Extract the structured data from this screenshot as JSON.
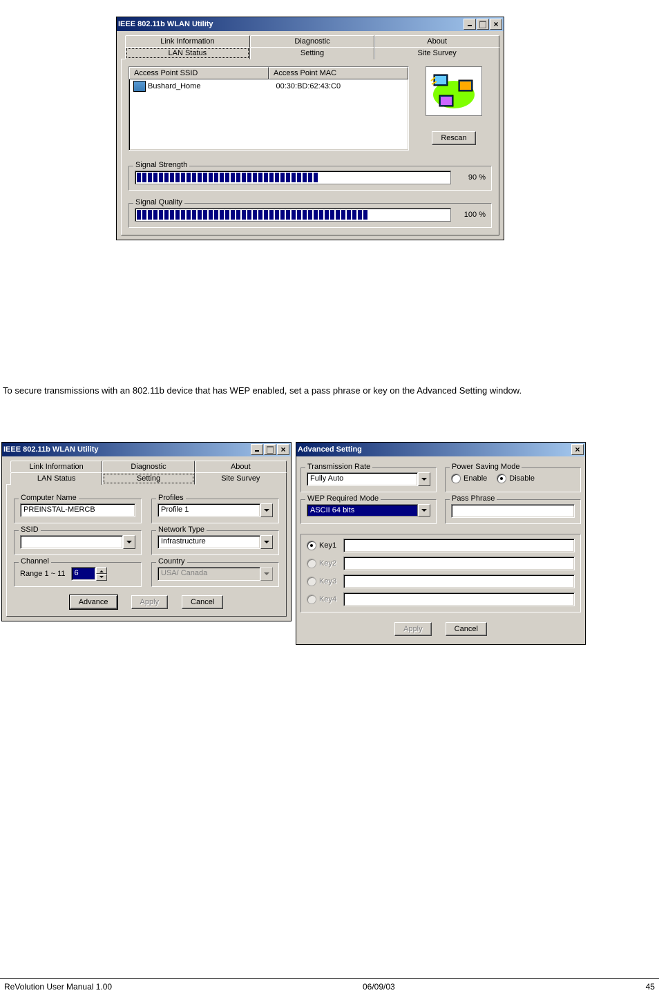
{
  "win1": {
    "title": "IEEE 802.11b WLAN Utility",
    "tabs_row1": [
      "Link Information",
      "Diagnostic",
      "About"
    ],
    "tabs_row2": [
      "LAN Status",
      "Setting",
      "Site Survey"
    ],
    "active_tab": "LAN Status",
    "list": {
      "col_ssid": "Access Point SSID",
      "col_mac": "Access Point MAC",
      "row_ssid": "Bushard_Home",
      "row_mac": "00:30:BD:62:43:C0"
    },
    "rescan": "Rescan",
    "signal_strength": {
      "label": "Signal Strength",
      "pct": "90 %",
      "segs": 33
    },
    "signal_quality": {
      "label": "Signal Quality",
      "pct": "100 %",
      "segs": 42
    }
  },
  "body_text": "To secure transmissions with an 802.11b device that has WEP enabled, set a pass phrase or key on the Advanced Setting window.",
  "win2": {
    "title": "IEEE 802.11b WLAN Utility",
    "tabs_row1": [
      "Link Information",
      "Diagnostic",
      "About"
    ],
    "tabs_row2": [
      "LAN Status",
      "Setting",
      "Site Survey"
    ],
    "active_tab": "Setting",
    "computer_name": {
      "label": "Computer Name",
      "value": "PREINSTAL-MERCB"
    },
    "profiles": {
      "label": "Profiles",
      "value": "Profile 1"
    },
    "ssid": {
      "label": "SSID",
      "value": ""
    },
    "network_type": {
      "label": "Network Type",
      "value": "Infrastructure"
    },
    "channel": {
      "label": "Channel",
      "range": "Range 1 ~ 11",
      "value": "6"
    },
    "country": {
      "label": "Country",
      "value": "USA/ Canada"
    },
    "advance": "Advance",
    "apply": "Apply",
    "cancel": "Cancel"
  },
  "win3": {
    "title": "Advanced Setting",
    "tx_rate": {
      "label": "Transmission Rate",
      "value": "Fully Auto"
    },
    "power": {
      "label": "Power Saving Mode",
      "enable": "Enable",
      "disable": "Disable",
      "selected": "Disable"
    },
    "wep": {
      "label": "WEP Required Mode",
      "value": "ASCII 64 bits"
    },
    "passphrase": {
      "label": "Pass Phrase",
      "value": ""
    },
    "keys": [
      "Key1",
      "Key2",
      "Key3",
      "Key4"
    ],
    "key_selected": 0,
    "apply": "Apply",
    "cancel": "Cancel"
  },
  "footer": {
    "left": "ReVolution User Manual 1.00",
    "center": "06/09/03",
    "right": "45"
  }
}
